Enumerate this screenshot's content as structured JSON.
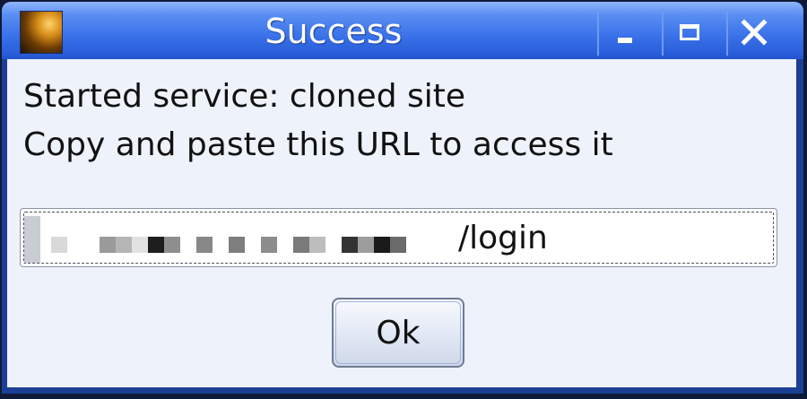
{
  "window": {
    "title": "Success",
    "controls": {
      "minimize": "minimize",
      "maximize": "maximize",
      "close": "close"
    }
  },
  "message": {
    "line1": "Started service: cloned site",
    "line2": "Copy and paste this URL to access it"
  },
  "url_field": {
    "visible_value": "/login"
  },
  "ok_button": {
    "label": "Ok"
  },
  "colors": {
    "titlebar": "#3d75ea",
    "client_bg": "#eef2fb",
    "text": "#111111"
  },
  "icons": {
    "app_icon": "app-icon",
    "minimize": "minimize-icon",
    "maximize": "maximize-icon",
    "close": "close-icon"
  }
}
